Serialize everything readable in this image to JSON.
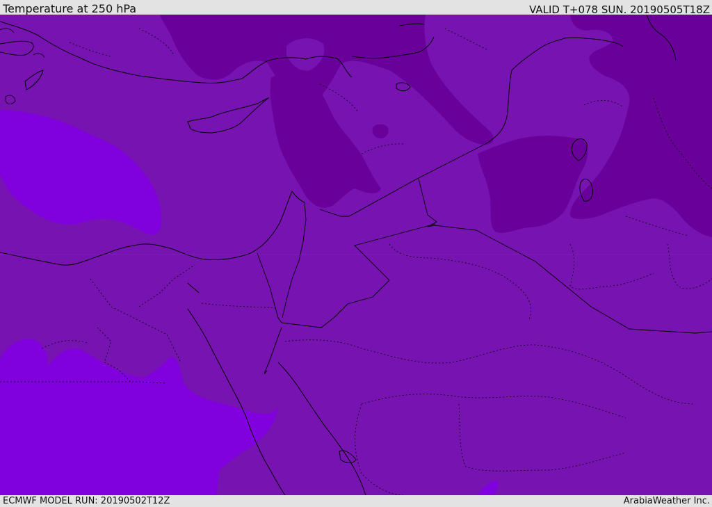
{
  "header": {
    "title": "Temperature at 250 hPa",
    "valid": "VALID T+078 SUN. 20190505T18Z"
  },
  "footer": {
    "model_run": "ECMWF MODEL RUN: 20190502T12Z",
    "credit": "ArabiaWeather Inc."
  },
  "colors": {
    "base_fill": "#7713b1",
    "warm_band": "#8100de",
    "cold_band": "#680099",
    "coast_line": "#000000"
  },
  "map": {
    "layers": [
      "temperature-base",
      "warm-band",
      "cold-band",
      "coastlines",
      "country-borders",
      "admin-borders"
    ]
  }
}
